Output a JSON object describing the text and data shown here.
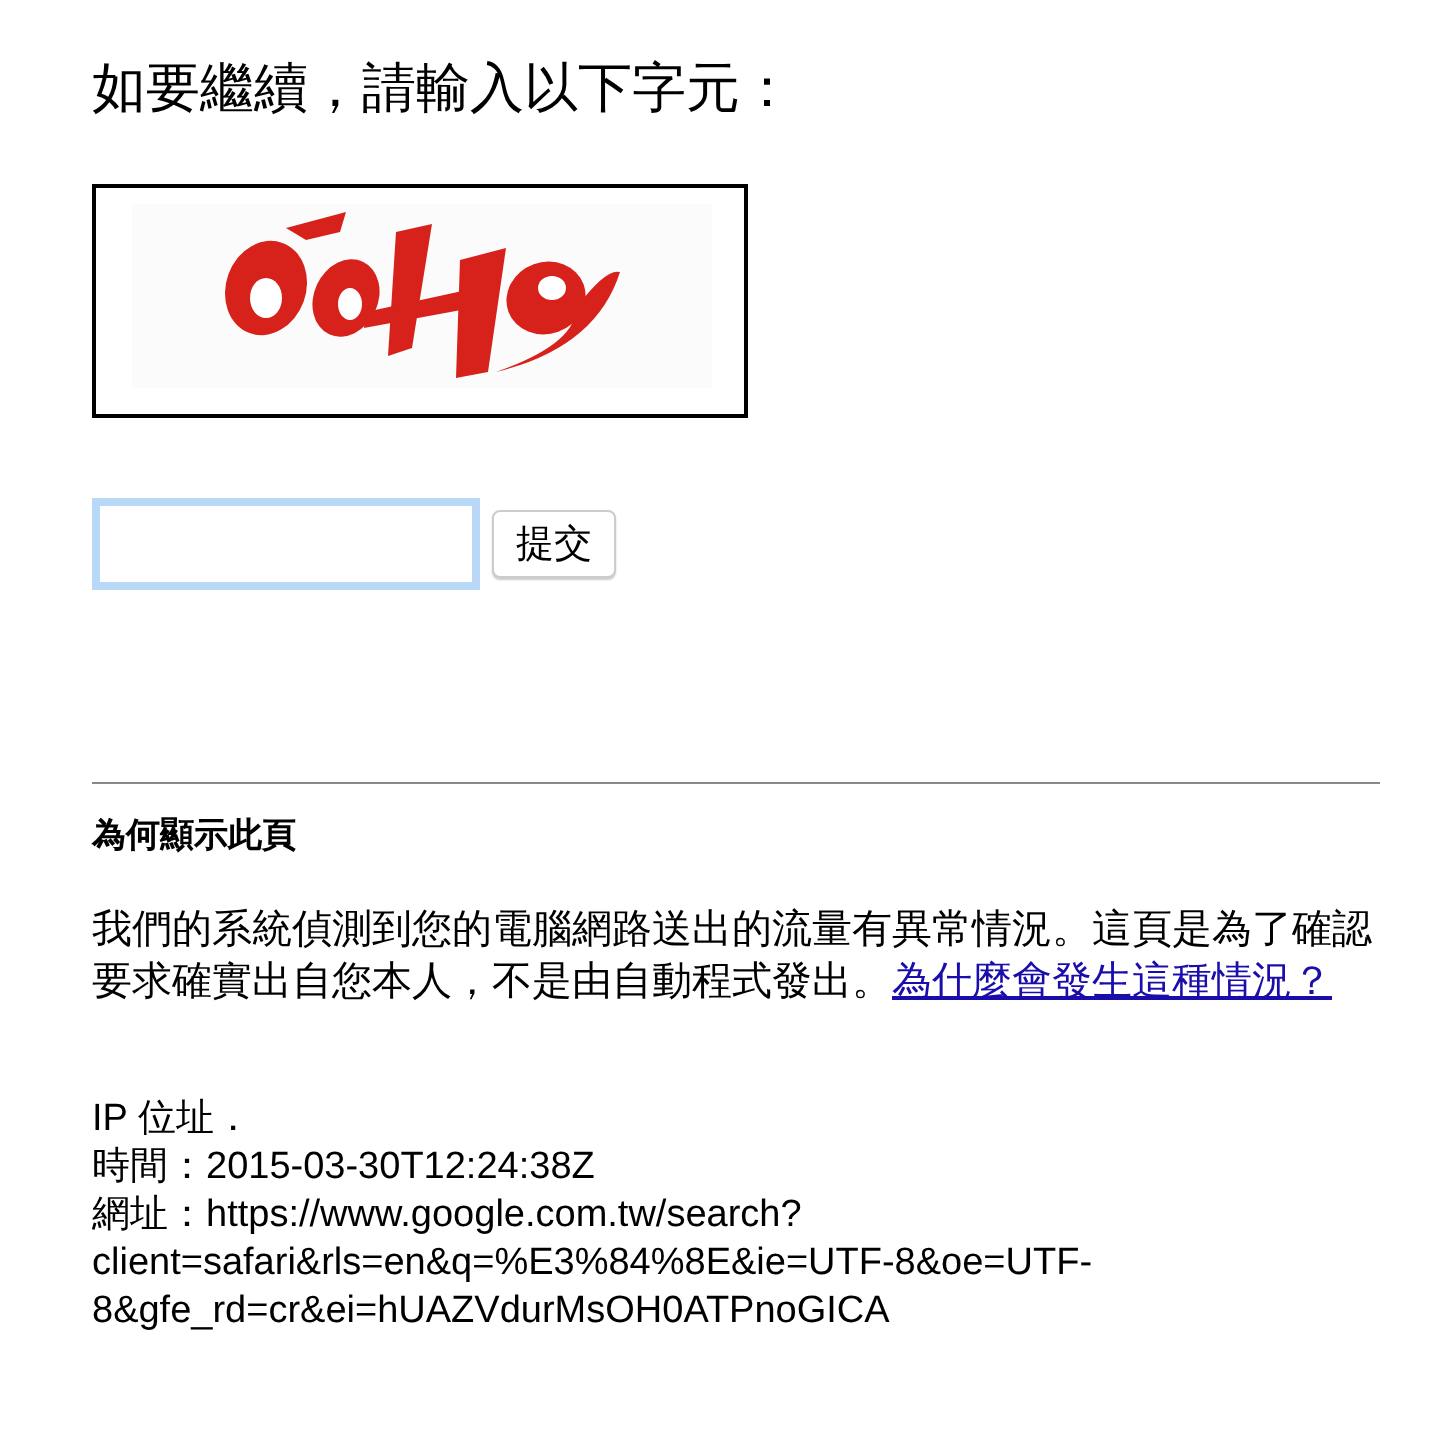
{
  "heading": "如要繼續，請輸入以下字元：",
  "answer_field": {
    "focused": true
  },
  "submit_button": "提交",
  "section_title": "為何顯示此頁",
  "explanation": {
    "text": "我們的系統偵測到您的電腦網路送出的流量有異常情況。這頁是為了確認要求確實出自您本人，不是由自動程式發出。",
    "link": "為什麼會發生這種情況？"
  },
  "details": [
    "IP 位址．",
    "時間：2015-03-30T12:24:38Z",
    "網址：https://www.google.com.tw/search?client=safari&rls=en&q=%E3%84%8E&ie=UTF-8&oe=UTF-8&gfe_rd=cr&ei=hUAZVdurMsOH0ATPnoGICA"
  ]
}
